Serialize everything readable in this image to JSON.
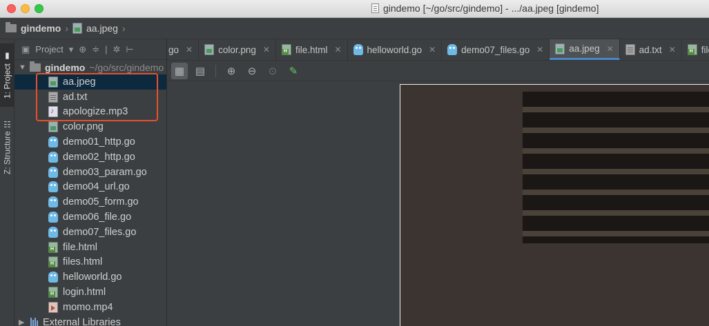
{
  "window": {
    "title": "gindemo [~/go/src/gindemo] - .../aa.jpeg [gindemo]"
  },
  "breadcrumb": [
    "gindemo",
    "aa.jpeg"
  ],
  "toolstrip": {
    "project_tab": "1: Project",
    "structure_tab": "Z: Structure"
  },
  "project_panel": {
    "header_label": "Project",
    "root_name": "gindemo",
    "root_path": "~/go/src/gindemo",
    "files": [
      {
        "name": "aa.jpeg",
        "icon": "image-file-icon"
      },
      {
        "name": "ad.txt",
        "icon": "text-file-icon"
      },
      {
        "name": "apologize.mp3",
        "icon": "audio-file-icon"
      },
      {
        "name": "color.png",
        "icon": "image-file-icon"
      },
      {
        "name": "demo01_http.go",
        "icon": "go-file-icon"
      },
      {
        "name": "demo02_http.go",
        "icon": "go-file-icon"
      },
      {
        "name": "demo03_param.go",
        "icon": "go-file-icon"
      },
      {
        "name": "demo04_url.go",
        "icon": "go-file-icon"
      },
      {
        "name": "demo05_form.go",
        "icon": "go-file-icon"
      },
      {
        "name": "demo06_file.go",
        "icon": "go-file-icon"
      },
      {
        "name": "demo07_files.go",
        "icon": "go-file-icon"
      },
      {
        "name": "file.html",
        "icon": "html-file-icon"
      },
      {
        "name": "files.html",
        "icon": "html-file-icon"
      },
      {
        "name": "helloworld.go",
        "icon": "go-file-icon"
      },
      {
        "name": "login.html",
        "icon": "html-file-icon"
      },
      {
        "name": "momo.mp4",
        "icon": "video-file-icon"
      }
    ],
    "external_libraries": "External Libraries"
  },
  "tabs": [
    {
      "label": "go",
      "partial": true
    },
    {
      "label": "color.png"
    },
    {
      "label": "file.html"
    },
    {
      "label": "helloworld.go"
    },
    {
      "label": "demo07_files.go"
    },
    {
      "label": "aa.jpeg",
      "active": true
    },
    {
      "label": "ad.txt"
    },
    {
      "label": "file"
    }
  ],
  "colors": {
    "highlight": "#e8502d",
    "active_tab_underline": "#4a88c7",
    "selection": "#0d293e"
  }
}
